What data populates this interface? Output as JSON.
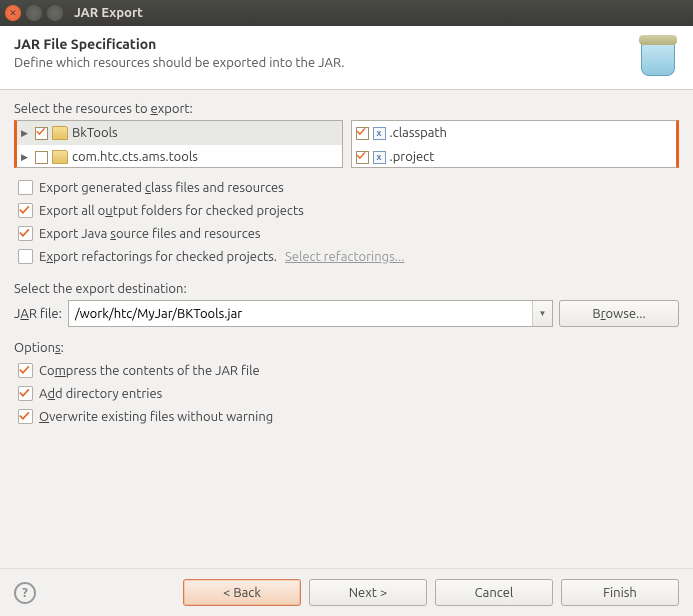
{
  "window": {
    "title": "JAR Export"
  },
  "header": {
    "title": "JAR File Specification",
    "subtitle": "Define which resources should be exported into the JAR."
  },
  "resources": {
    "label_pre": "Select the resources to ",
    "label_u": "e",
    "label_post": "xport:",
    "left": [
      {
        "name": "BkTools",
        "checked": true,
        "expandable": true
      },
      {
        "name": "com.htc.cts.ams.tools",
        "checked": false,
        "expandable": true
      }
    ],
    "right": [
      {
        "name": ".classpath",
        "checked": true
      },
      {
        "name": ".project",
        "checked": true
      }
    ]
  },
  "exportOptions": [
    {
      "label_pre": "Export generated ",
      "label_u": "c",
      "label_post": "lass files and resources",
      "checked": false
    },
    {
      "label_pre": "Export all o",
      "label_u": "u",
      "label_post": "tput folders for checked projects",
      "checked": true
    },
    {
      "label_pre": "Export Java ",
      "label_u": "s",
      "label_post": "ource files and resources",
      "checked": true
    },
    {
      "label_pre": "E",
      "label_u": "x",
      "label_post": "port refactorings for checked projects.",
      "checked": false,
      "link": "Select refactorings..."
    }
  ],
  "destination": {
    "label": "Select the export destination:",
    "field_label_pre": "J",
    "field_label_u": "A",
    "field_label_post": "R file:",
    "value": "/work/htc/MyJar/BKTools.jar",
    "browse_pre": "B",
    "browse_u": "r",
    "browse_post": "owse..."
  },
  "options": {
    "label_pre": "Option",
    "label_u": "s",
    "label_post": ":",
    "items": [
      {
        "label_pre": "Co",
        "label_u": "m",
        "label_post": "press the contents of the JAR file",
        "checked": true
      },
      {
        "label_pre": "A",
        "label_u": "d",
        "label_post": "d directory entries",
        "checked": true
      },
      {
        "label_pre": "",
        "label_u": "O",
        "label_post": "verwrite existing files without warning",
        "checked": true
      }
    ]
  },
  "footer": {
    "back": "< Back",
    "next": "Next >",
    "cancel": "Cancel",
    "finish": "Finish"
  }
}
